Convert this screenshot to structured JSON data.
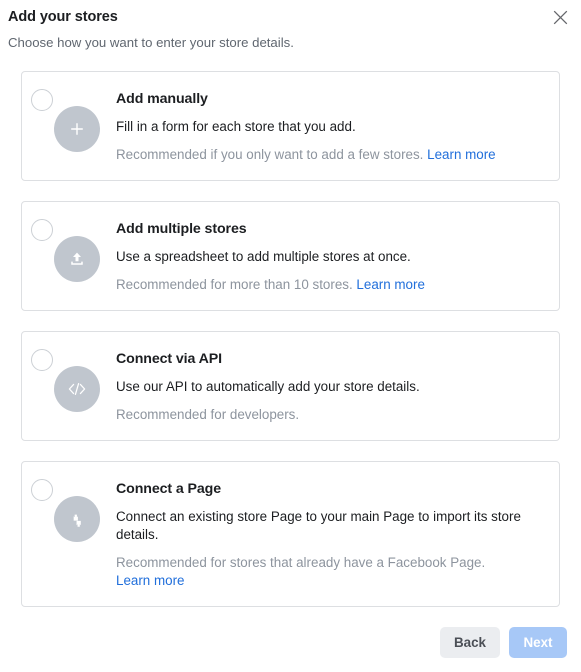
{
  "dialog": {
    "title": "Add your stores",
    "subtitle": "Choose how you want to enter your store details.",
    "close_icon": "close-icon"
  },
  "options": [
    {
      "id": "add-manually",
      "icon": "plus-icon",
      "title": "Add manually",
      "description": "Fill in a form for each store that you add.",
      "recommendation": "Recommended if you only want to add a few stores.",
      "link_label": "Learn more",
      "selected": false
    },
    {
      "id": "add-multiple-stores",
      "icon": "upload-icon",
      "title": "Add multiple stores",
      "description": "Use a spreadsheet to add multiple stores at once.",
      "recommendation": "Recommended for more than 10 stores.",
      "link_label": "Learn more",
      "selected": false
    },
    {
      "id": "connect-via-api",
      "icon": "code-icon",
      "title": "Connect via API",
      "description": "Use our API to automatically add your store details.",
      "recommendation": "Recommended for developers.",
      "link_label": "",
      "selected": false
    },
    {
      "id": "connect-a-page",
      "icon": "connect-arrows-icon",
      "title": "Connect a Page",
      "description": "Connect an existing store Page to your main Page to import its store details.",
      "recommendation": "Recommended for stores that already have a Facebook Page.",
      "link_label": "Learn more",
      "selected": false
    }
  ],
  "footer": {
    "back_label": "Back",
    "next_label": "Next",
    "next_disabled": true
  },
  "colors": {
    "link": "#216fdb",
    "primary_disabled": "#a7c8f7",
    "secondary": "#ebedf0",
    "icon_circle": "#c0c6ce",
    "border": "#dddfe2",
    "text": "#1c1e21",
    "muted": "#8d949e"
  }
}
